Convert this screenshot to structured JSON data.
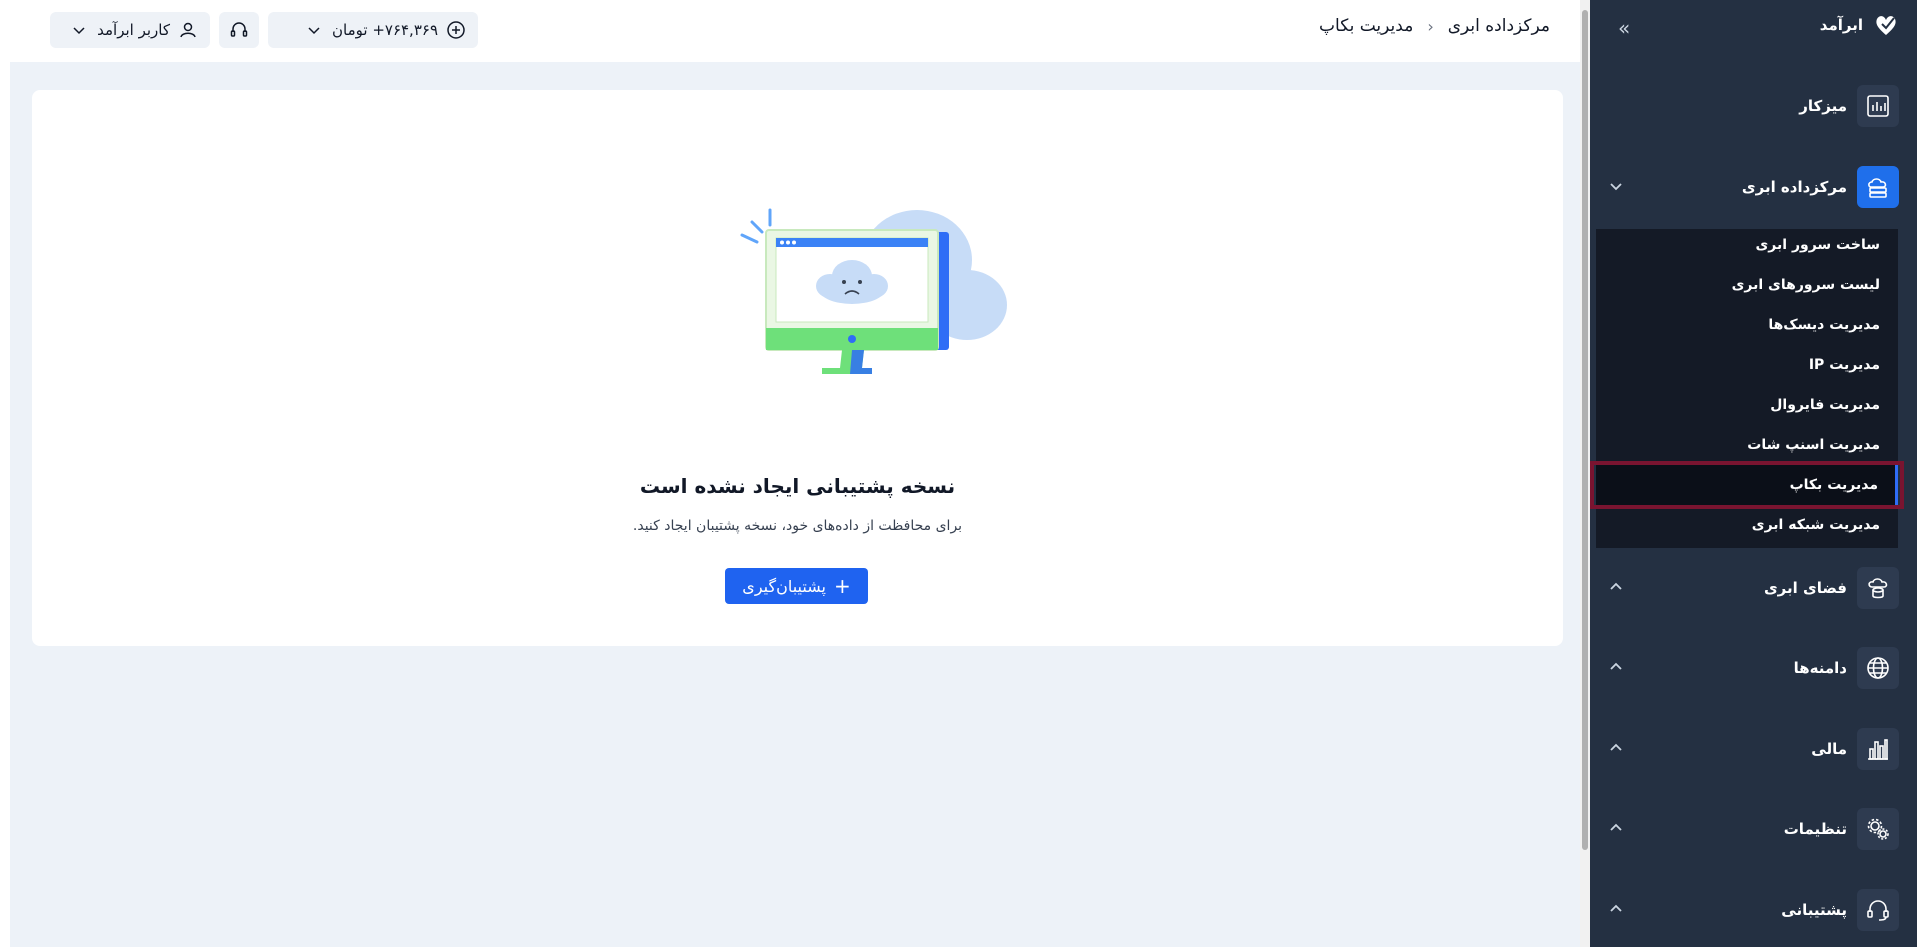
{
  "sidebar": {
    "brand": "ابرآمد",
    "items": [
      {
        "label": "میزکار",
        "icon": "dashboard-chart-icon"
      },
      {
        "label": "مرکزداده ابری",
        "icon": "cloud-datacenter-icon"
      },
      {
        "label": "فضای ابری",
        "icon": "cloud-storage-icon"
      },
      {
        "label": "دامنه‌ها",
        "icon": "globe-icon"
      },
      {
        "label": "مالی",
        "icon": "finance-chart-icon"
      },
      {
        "label": "تنظیمات",
        "icon": "gears-icon"
      },
      {
        "label": "پشتیبانی",
        "icon": "headset-icon"
      }
    ],
    "submenu": [
      {
        "label": "ساخت سرور ابری"
      },
      {
        "label": "لیست سرورهای ابری"
      },
      {
        "label": "مدیریت دیسک‌ها"
      },
      {
        "label": "مدیریت IP"
      },
      {
        "label": "مدیریت فایروال"
      },
      {
        "label": "مدیریت اسنپ شات"
      },
      {
        "label": "مدیریت بکاپ"
      },
      {
        "label": "مدیریت شبکه ابری"
      }
    ]
  },
  "header": {
    "breadcrumb": [
      "مرکزداده ابری",
      "مدیریت بکاپ"
    ],
    "balance": "۷۶۴,۳۶۹+ تومان",
    "user": "کاربر ابرآمد"
  },
  "empty_state": {
    "title": "نسخه پشتیبانی ایجاد نشده است",
    "subtitle": "برای محافظت از داده‌های خود، نسخه پشتیبان ایجاد کنید.",
    "button": "پشتیبان‌گیری"
  },
  "colors": {
    "sidebar_bg": "#243042",
    "accent": "#1f63f0",
    "highlight": "#7a1430"
  }
}
